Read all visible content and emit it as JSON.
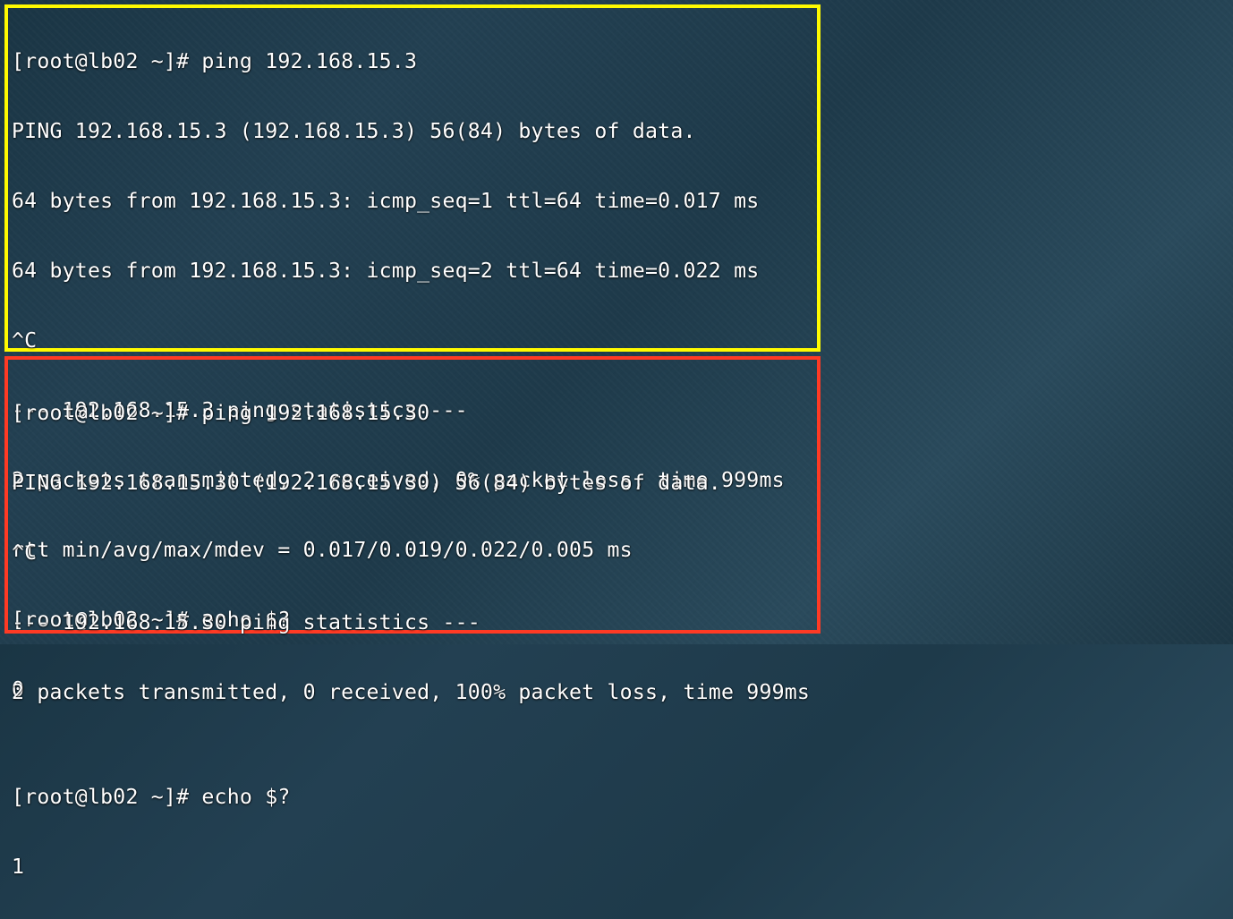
{
  "colors": {
    "yellow_border": "#fffa00",
    "red_border": "#ff3a24",
    "text": "#ffffff"
  },
  "blocks": {
    "success": {
      "lines": [
        "[root@lb02 ~]# ping 192.168.15.3",
        "PING 192.168.15.3 (192.168.15.3) 56(84) bytes of data.",
        "64 bytes from 192.168.15.3: icmp_seq=1 ttl=64 time=0.017 ms",
        "64 bytes from 192.168.15.3: icmp_seq=2 ttl=64 time=0.022 ms",
        "^C",
        "--- 192.168.15.3 ping statistics ---",
        "2 packets transmitted, 2 received, 0% packet loss, time 999ms",
        "rtt min/avg/max/mdev = 0.017/0.019/0.022/0.005 ms",
        "[root@lb02 ~]# echo $?",
        "0"
      ]
    },
    "failure": {
      "lines": [
        "[root@lb02 ~]# ping 192.168.15.30",
        "PING 192.168.15.30 (192.168.15.30) 56(84) bytes of data.",
        "^C",
        "--- 192.168.15.30 ping statistics ---",
        "2 packets transmitted, 0 received, 100% packet loss, time 999ms",
        "",
        "[root@lb02 ~]# echo $?",
        "1"
      ]
    }
  }
}
